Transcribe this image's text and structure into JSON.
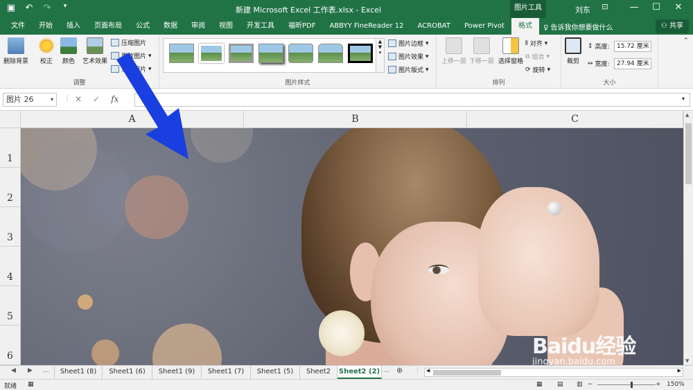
{
  "titlebar": {
    "quick_access": [
      "save-icon",
      "undo-icon",
      "redo-icon",
      "customize-icon"
    ],
    "title": "新建 Microsoft Excel 工作表.xlsx  -  Excel",
    "context_tools": "图片工具",
    "user": "刘东",
    "window_buttons": [
      "ribbon-display-icon",
      "minimize-icon",
      "maximize-icon",
      "close-icon"
    ]
  },
  "tabs": {
    "items": [
      "文件",
      "开始",
      "插入",
      "页面布局",
      "公式",
      "数据",
      "审阅",
      "视图",
      "开发工具",
      "福昕PDF",
      "ABBYY FineReader 12",
      "ACROBAT",
      "Power Pivot",
      "格式"
    ],
    "active": "格式",
    "tell_me": "告诉我你想要做什么",
    "share": "共享"
  },
  "ribbon": {
    "remove_bg": "删除背景",
    "corrections": "校正",
    "color": "颜色",
    "artistic": "艺术效果",
    "compress": "压缩图片",
    "change": "更改图片",
    "reset": "重设图片",
    "adjust_label": "调整",
    "border": "图片边框",
    "effects": "图片效果",
    "layout": "图片版式",
    "styles_label": "图片样式",
    "bring_forward": "上移一层",
    "send_backward": "下移一层",
    "selection_pane": "选择窗格",
    "align": "对齐",
    "group": "组合",
    "rotate": "旋转",
    "arrange_label": "排列",
    "crop": "裁剪",
    "height_label": "高度:",
    "height_value": "15.72 厘米",
    "width_label": "宽度:",
    "width_value": "27.94 厘米",
    "size_label": "大小"
  },
  "formula_bar": {
    "name_box": "图片 26",
    "formula": ""
  },
  "grid": {
    "columns": [
      "A",
      "B",
      "C"
    ],
    "rows": [
      "1",
      "2",
      "3",
      "4",
      "5",
      "6"
    ]
  },
  "sheets": {
    "items": [
      "Sheet1 (8)",
      "Sheet1 (6)",
      "Sheet1 (9)",
      "Sheet1 (7)",
      "Sheet1 (5)",
      "Sheet2",
      "Sheet2 (2)"
    ],
    "active": "Sheet2 (2)",
    "more": "..."
  },
  "status": {
    "ready": "就绪",
    "zoom": "150%"
  },
  "watermark": {
    "logo": "Baidu经验",
    "url": "jingyan.baidu.com"
  },
  "colors": {
    "excel_green": "#217346",
    "arrow_blue": "#1a3fe0"
  }
}
